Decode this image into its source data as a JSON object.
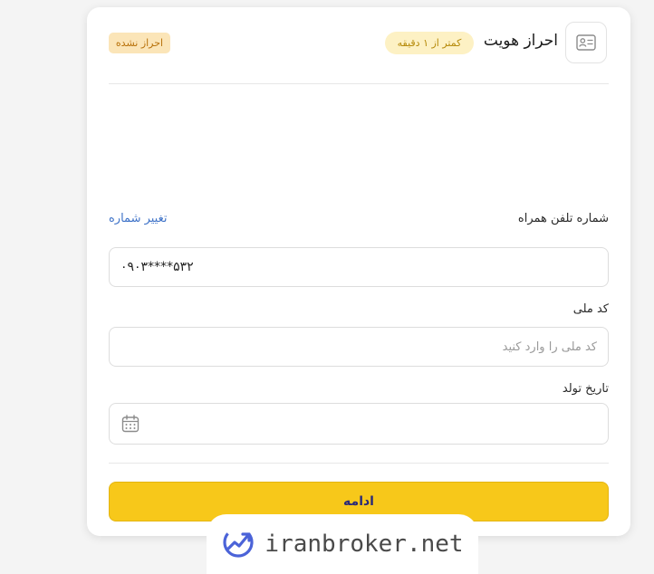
{
  "header": {
    "icon": "id-card-icon",
    "title": "احراز هویت",
    "time_badge": "کمتر از ۱ دقیقه",
    "status_badge": "احراز نشده"
  },
  "form": {
    "phone_label": "شماره تلفن همراه",
    "change_number_label": "تغییر شماره",
    "phone_value": "۰۹۰۳****۵۳۲",
    "national_id_label": "کد ملی",
    "national_id_placeholder": "کد ملی را وارد کنید",
    "national_id_value": "",
    "birthdate_label": "تاریخ تولد",
    "birthdate_icon": "calendar-icon",
    "continue_label": "ادامه"
  },
  "watermark": {
    "logo": "iranbroker-logo",
    "text": "iranbroker.net"
  },
  "colors": {
    "accent_yellow": "#f7c81a",
    "button_text": "#2b2a78",
    "link_blue": "#3f73c8",
    "time_badge_bg": "#fdf1c4",
    "status_badge_bg": "#fbe5b8",
    "status_badge_text": "#b8710a"
  }
}
